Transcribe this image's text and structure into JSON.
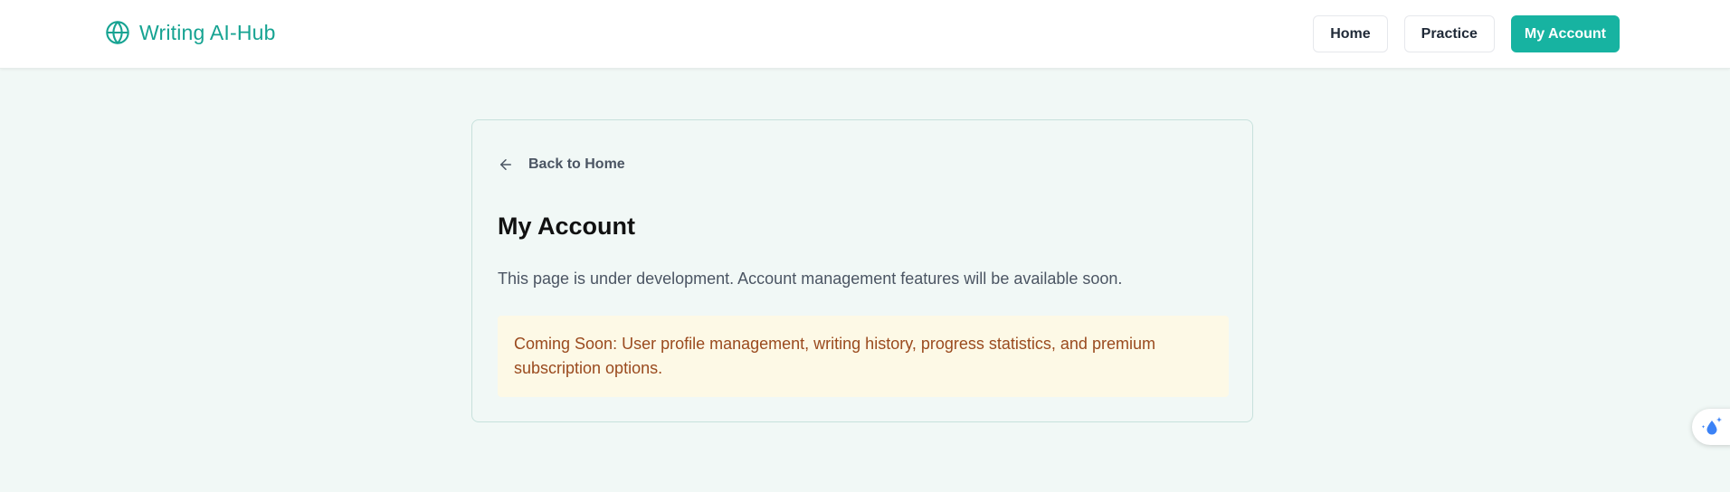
{
  "header": {
    "brand_name": "Writing AI-Hub",
    "brand_icon": "globe-icon",
    "nav": {
      "home_label": "Home",
      "practice_label": "Practice",
      "account_label": "My Account"
    }
  },
  "main": {
    "back_label": "Back to Home",
    "back_icon": "arrow-left-icon",
    "title": "My Account",
    "description": "This page is under development. Account management features will be available soon.",
    "notice": "Coming Soon: User profile management, writing history, progress statistics, and premium subscription options."
  },
  "floating": {
    "icon": "sparkle-drop-icon"
  },
  "colors": {
    "accent": "#17b3a1",
    "brand_text": "#16a392",
    "page_bg": "#f1f8f6",
    "notice_bg": "#fdf9e6",
    "notice_text": "#9a4a1e"
  }
}
